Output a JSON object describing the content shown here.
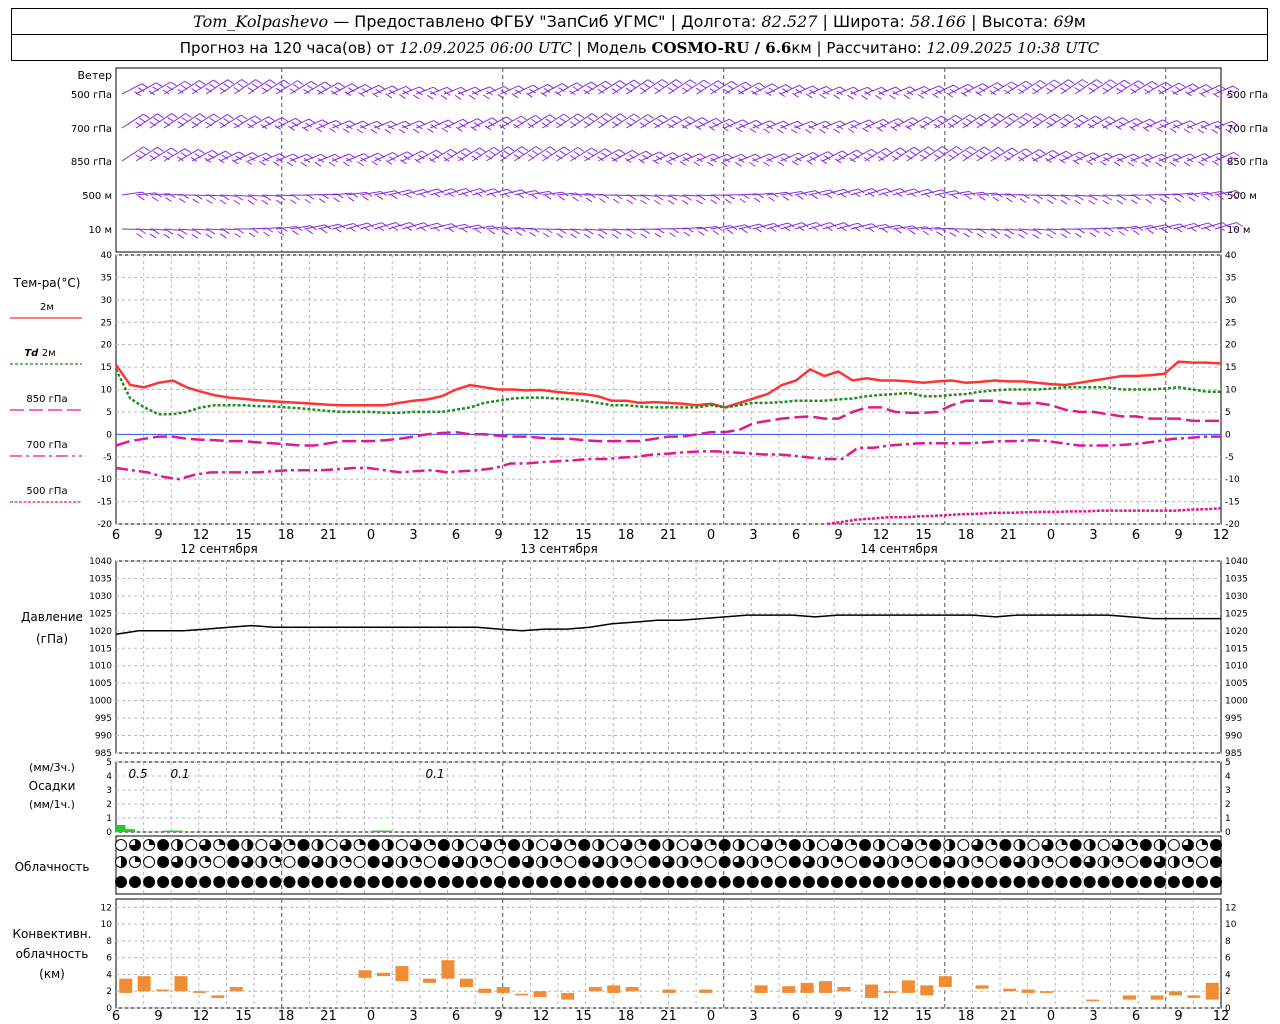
{
  "header": {
    "station": "Tom_Kolpashevo",
    "provider": "— Предоставлено ФГБУ \"ЗапСиб УГМС\"",
    "lon_label": "Долгота:",
    "lon_value": "82.527",
    "lat_label": "Широта:",
    "lat_value": "58.166",
    "alt_label": "Высота:",
    "alt_value": "69",
    "alt_unit": "м",
    "forecast_label": "Прогноз на 120 часа(ов) от",
    "forecast_start": "12.09.2025 06:00 UTC",
    "model_label": "Модель",
    "model_name": "COSMO-RU / 6.6",
    "model_unit": "км",
    "calc_label": "Рассчитано:",
    "calc_time": "12.09.2025 10:38 UTC"
  },
  "wind_panel": {
    "title": "Ветер",
    "levels": [
      "500 гПа",
      "700 гПа",
      "850 гПа",
      "500 м",
      "10  м"
    ],
    "barb_color": "#8a2be2"
  },
  "temp_panel": {
    "title": "Тем-ра(°С)",
    "legend": [
      {
        "label": "2м",
        "italic_prefix": "",
        "color": "#ff3333",
        "dash": "solid"
      },
      {
        "label": "2м",
        "italic_prefix": "Td",
        "color": "#228b22",
        "dash": "dot"
      },
      {
        "label": "850 гПа",
        "italic_prefix": "",
        "color": "#e0198c",
        "dash": "dash"
      },
      {
        "label": "700 гПа",
        "italic_prefix": "",
        "color": "#e0198c",
        "dash": "dashdot"
      },
      {
        "label": "500 гПа",
        "italic_prefix": "",
        "color": "#e0198c",
        "dash": "dense"
      }
    ],
    "date_labels": [
      "12 сентября",
      "13 сентября",
      "14 сентября"
    ]
  },
  "pressure_panel": {
    "title": "Давление",
    "unit": "(гПа)"
  },
  "precip_panel": {
    "unit_top": "(мм/3ч.)",
    "title": "Осадки",
    "unit_bottom": "(мм/1ч.)",
    "annotations": [
      "0.5",
      "0.1",
      "0.1"
    ]
  },
  "cloud_panel": {
    "title": "Облачность"
  },
  "conv_panel": {
    "title_1": "Конвективн.",
    "title_2": "облачность",
    "unit": "(км)"
  },
  "chart_data": [
    {
      "type": "line",
      "name": "temperature",
      "x": [
        0,
        1,
        2,
        3,
        4,
        5,
        6,
        7,
        8,
        9,
        10,
        11,
        12,
        13,
        14,
        15,
        16,
        17,
        18,
        19,
        20,
        21,
        22,
        23,
        24,
        25,
        26,
        27,
        28,
        29,
        30,
        31,
        32,
        33,
        34,
        35,
        36,
        37,
        38,
        39,
        40,
        41,
        42,
        43,
        44,
        45,
        46,
        47,
        48,
        49,
        50,
        51,
        52,
        53,
        54,
        55,
        56,
        57,
        58,
        59,
        60,
        61,
        62,
        63,
        64,
        65,
        66,
        67,
        68,
        69,
        70,
        71,
        72,
        73,
        74,
        75,
        76,
        77,
        78
      ],
      "x_ticks": [
        "6",
        "9",
        "12",
        "15",
        "18",
        "21",
        "0",
        "3",
        "6",
        "9",
        "12",
        "15",
        "18",
        "21",
        "0",
        "3",
        "6",
        "9",
        "12",
        "15",
        "18",
        "21",
        "0",
        "3",
        "6",
        "9",
        "12"
      ],
      "ylim": [
        -20,
        40
      ],
      "yticks": [
        -20,
        -15,
        -10,
        -5,
        0,
        5,
        10,
        15,
        20,
        25,
        30,
        35,
        40
      ],
      "series": [
        {
          "name": "2м",
          "color": "#ff3333",
          "values": [
            15.5,
            11,
            10.5,
            11.5,
            12,
            10.5,
            9.5,
            8.7,
            8.2,
            7.9,
            7.6,
            7.4,
            7.2,
            7,
            6.8,
            6.6,
            6.5,
            6.5,
            6.5,
            6.5,
            7,
            7.5,
            7.8,
            8.5,
            10,
            11,
            10.5,
            10,
            10,
            9.8,
            9.9,
            9.5,
            9.2,
            9,
            8.5,
            7.5,
            7.5,
            7,
            7.2,
            7,
            6.8,
            6.5,
            6.8,
            6,
            7,
            8,
            9,
            11,
            12,
            14.5,
            13,
            14,
            12,
            12.5,
            12,
            12,
            11.8,
            11.5,
            11.8,
            12,
            11.5,
            11.7,
            12,
            11.8,
            11.8,
            11.5,
            11.2,
            11,
            11.5,
            12,
            12.5,
            13,
            13,
            13.2,
            13.5,
            16.2,
            16,
            16,
            15.8
          ]
        },
        {
          "name": "Td 2м",
          "color": "#228b22",
          "values": [
            14.5,
            8,
            6,
            4.5,
            4.5,
            5,
            6,
            6.5,
            6.5,
            6.5,
            6.3,
            6.2,
            6,
            5.8,
            5.5,
            5.2,
            5,
            5,
            5,
            4.8,
            4.8,
            5,
            5,
            5,
            5.5,
            6,
            7,
            7.5,
            8,
            8.2,
            8.2,
            8,
            7.8,
            7.5,
            7,
            6.5,
            6.5,
            6.2,
            6,
            6,
            6,
            6,
            6.5,
            6,
            6.5,
            7,
            7,
            7.2,
            7.5,
            7.5,
            7.5,
            7.8,
            8,
            8.5,
            8.8,
            9,
            9.2,
            8.5,
            8.5,
            8.8,
            9,
            9.5,
            9.8,
            10,
            10,
            10,
            10.2,
            10.5,
            10.5,
            10.5,
            10.5,
            10,
            10,
            10,
            10.2,
            10.5,
            10,
            9.5,
            9.5
          ]
        },
        {
          "name": "850 гПа",
          "color": "#e0198c",
          "values": [
            -2.5,
            -1.5,
            -1,
            -0.5,
            -0.5,
            -1,
            -1.2,
            -1.3,
            -1.5,
            -1.5,
            -1.8,
            -2,
            -2.2,
            -2.5,
            -2.5,
            -2,
            -1.5,
            -1.5,
            -1.5,
            -1.3,
            -1,
            -0.5,
            0,
            0.3,
            0.5,
            0,
            0,
            -0.3,
            -0.5,
            -0.5,
            -0.8,
            -1,
            -1,
            -1.3,
            -1.5,
            -1.5,
            -1.5,
            -1.5,
            -1,
            -0.5,
            -0.5,
            0,
            0.5,
            0.5,
            1,
            2.5,
            3,
            3.5,
            3.8,
            4,
            3.5,
            3.5,
            5,
            6,
            6,
            5,
            4.8,
            4.8,
            5,
            6.5,
            7.5,
            7.5,
            7.5,
            7,
            6.8,
            7,
            6.5,
            5.5,
            5,
            5,
            4.5,
            4,
            4,
            3.5,
            3.5,
            3.5,
            3,
            3,
            3
          ]
        },
        {
          "name": "700 гПа",
          "color": "#e0198c",
          "values": [
            -7.5,
            -8,
            -8.5,
            -9.5,
            -10,
            -9,
            -8.5,
            -8.5,
            -8.5,
            -8.5,
            -8.2,
            -8,
            -8,
            -8,
            -7.8,
            -7.5,
            -7.5,
            -8,
            -8.5,
            -8.2,
            -8,
            -8.5,
            -8.2,
            -8,
            -7.5,
            -6.5,
            -6.5,
            -6.2,
            -6,
            -5.8,
            -5.5,
            -5.5,
            -5.2,
            -5,
            -4.5,
            -4.3,
            -4,
            -3.8,
            -3.8,
            -4,
            -4.2,
            -4.5,
            -4.5,
            -4.8,
            -5.2,
            -5.5,
            -5.5,
            -3,
            -3,
            -2.5,
            -2.2,
            -2,
            -2,
            -2,
            -2,
            -1.8,
            -1.5,
            -1.5,
            -1.3,
            -1.5,
            -2,
            -2.5,
            -2.5,
            -2.5,
            -2.3,
            -2,
            -1.5,
            -1,
            -0.8,
            -0.5,
            -0.5
          ]
        },
        {
          "name": "500 гПа",
          "color": "#e0198c",
          "values": [
            null,
            null,
            null,
            null,
            null,
            null,
            null,
            null,
            null,
            null,
            null,
            null,
            null,
            null,
            null,
            null,
            null,
            null,
            null,
            null,
            null,
            null,
            null,
            null,
            null,
            null,
            null,
            null,
            null,
            null,
            null,
            null,
            null,
            null,
            null,
            null,
            null,
            null,
            null,
            null,
            null,
            null,
            null,
            null,
            null,
            null,
            null,
            -20,
            -19.5,
            -19,
            -18.8,
            -18.5,
            -18.5,
            -18.3,
            -18.2,
            -18,
            -17.8,
            -17.7,
            -17.5,
            -17.5,
            -17.4,
            -17.3,
            -17.3,
            -17.2,
            -17.2,
            -17,
            -17,
            -17,
            -17,
            -17,
            -17,
            -16.8,
            -16.7,
            -16.5
          ]
        }
      ]
    },
    {
      "type": "line",
      "name": "pressure",
      "ylim": [
        985,
        1040
      ],
      "yticks": [
        985,
        990,
        995,
        1000,
        1005,
        1010,
        1015,
        1020,
        1025,
        1030,
        1035,
        1040
      ],
      "series": [
        {
          "name": "Давление",
          "color": "#000000",
          "values": [
            1019,
            1020,
            1020,
            1020,
            1020.5,
            1021,
            1021.5,
            1021,
            1021,
            1021,
            1021,
            1021,
            1021,
            1021,
            1021,
            1021,
            1021,
            1020.5,
            1020,
            1020.5,
            1020.5,
            1021,
            1022,
            1022.5,
            1023,
            1023,
            1023.5,
            1024,
            1024.5,
            1024.5,
            1024.5,
            1024,
            1024.5,
            1024.5,
            1024.5,
            1024.5,
            1024.5,
            1024.5,
            1024.5,
            1024,
            1024.5,
            1024.5,
            1024.5,
            1024.5,
            1024.5,
            1024,
            1023.5,
            1023.5,
            1023.5,
            1023.5
          ]
        }
      ]
    },
    {
      "type": "bar",
      "name": "precipitation",
      "ylim": [
        0,
        5
      ],
      "yticks": [
        0,
        1,
        2,
        3,
        4,
        5
      ],
      "series": [
        {
          "name": "Осадки",
          "color": "#22cc22",
          "values": [
            0.5,
            0.2,
            0,
            0,
            0,
            0.1,
            0.1,
            0,
            0,
            0,
            0,
            0,
            0,
            0,
            0,
            0,
            0,
            0,
            0,
            0,
            0,
            0,
            0,
            0,
            0,
            0,
            0,
            0.1,
            0.1
          ]
        }
      ]
    },
    {
      "type": "bar",
      "name": "convective_clouds",
      "ylim": [
        0,
        13
      ],
      "yticks": [
        0,
        2,
        4,
        6,
        8,
        10,
        12
      ],
      "series": [
        {
          "name": "Конвективн. облачность",
          "color": "#f08c35",
          "bars": [
            [
              0.5,
              1.8,
              3.5
            ],
            [
              1.5,
              2,
              3.8
            ],
            [
              2.5,
              2,
              2.2
            ],
            [
              3.5,
              2,
              3.8
            ],
            [
              4.5,
              1.8,
              2
            ],
            [
              5.5,
              1.2,
              1.5
            ],
            [
              6.5,
              2,
              2.5
            ],
            [
              13.5,
              3.6,
              4.5
            ],
            [
              14.5,
              3.8,
              4.2
            ],
            [
              15.5,
              3.2,
              5
            ],
            [
              17,
              3,
              3.5
            ],
            [
              18,
              3.5,
              5.7
            ],
            [
              19,
              2.5,
              3.5
            ],
            [
              20,
              1.8,
              2.3
            ],
            [
              21,
              1.8,
              2.5
            ],
            [
              22,
              1.5,
              1.7
            ],
            [
              23,
              1.3,
              2
            ],
            [
              24.5,
              1,
              1.8
            ],
            [
              26,
              2,
              2.5
            ],
            [
              27,
              1.8,
              2.7
            ],
            [
              28,
              2,
              2.5
            ],
            [
              30,
              1.8,
              2.2
            ],
            [
              32,
              1.8,
              2.2
            ],
            [
              35,
              1.8,
              2.7
            ],
            [
              36.5,
              1.8,
              2.6
            ],
            [
              37.5,
              1.8,
              3
            ],
            [
              38.5,
              1.8,
              3.2
            ],
            [
              39.5,
              2,
              2.5
            ],
            [
              41,
              1.2,
              2.8
            ],
            [
              42,
              1.8,
              2
            ],
            [
              43,
              1.8,
              3.3
            ],
            [
              44,
              1.5,
              2.7
            ],
            [
              45,
              2.5,
              3.8
            ],
            [
              47,
              2.3,
              2.7
            ],
            [
              48.5,
              2,
              2.3
            ],
            [
              49.5,
              1.8,
              2.2
            ],
            [
              50.5,
              1.8,
              2
            ],
            [
              53,
              0.8,
              1
            ],
            [
              55,
              1,
              1.5
            ],
            [
              56.5,
              1,
              1.5
            ],
            [
              57.5,
              1.5,
              2
            ],
            [
              58.5,
              1.2,
              1.5
            ],
            [
              59.5,
              1,
              3
            ]
          ]
        }
      ]
    }
  ]
}
